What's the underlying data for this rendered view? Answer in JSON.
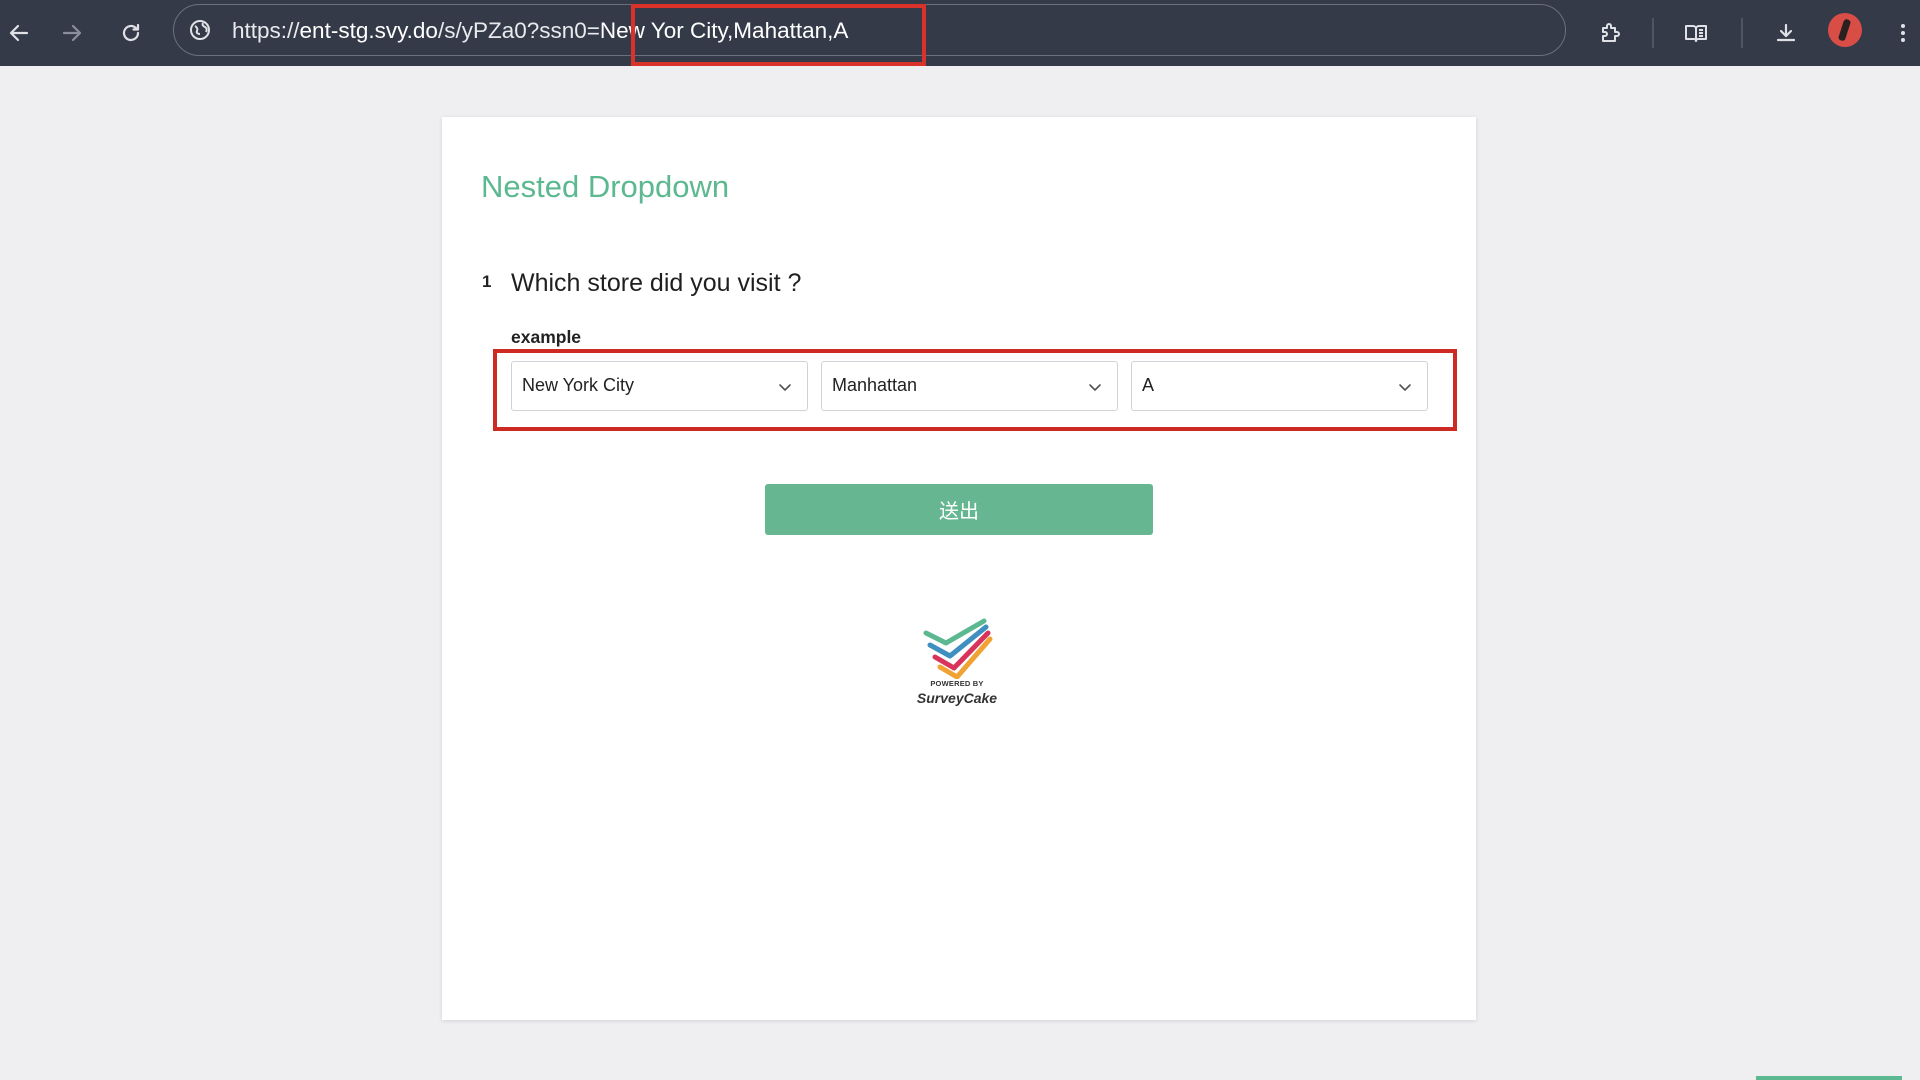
{
  "browser": {
    "url_prefix": "https://",
    "url_host": "ent-stg.svy.do",
    "url_path": "/s/yPZa0?ssn0=",
    "url_query_value": "New Yor City,Mahattan,A"
  },
  "survey": {
    "title": "Nested Dropdown",
    "question": {
      "number": "1",
      "text": "Which store did you visit ?",
      "description": "example",
      "dropdowns": [
        {
          "value": "New York City"
        },
        {
          "value": "Manhattan"
        },
        {
          "value": "A"
        }
      ]
    },
    "submit_label": "送出",
    "footer": {
      "powered_by": "POWERED BY",
      "brand_name": "SurveyCake"
    }
  },
  "colors": {
    "accent_green": "#5cb890",
    "button_green": "#66b791",
    "annotation_red": "#d8322a",
    "toolbar_bg": "#353a49"
  }
}
